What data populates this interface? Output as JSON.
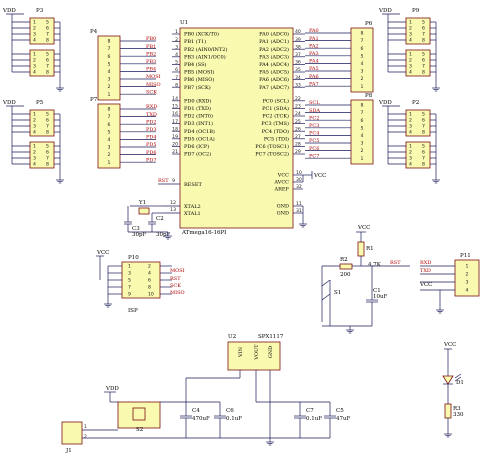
{
  "headers": {
    "p3": {
      "ref": "P3",
      "top": "VDD"
    },
    "p4": {
      "ref": "P4"
    },
    "p5": {
      "ref": "P5",
      "top": "VDD"
    },
    "p6": {
      "ref": "P6"
    },
    "p7": {
      "ref": "P7"
    },
    "p8": {
      "ref": "P8"
    },
    "p9": {
      "ref": "P9",
      "top": "VDD"
    },
    "p2": {
      "ref": "P2",
      "top": "VDD"
    },
    "pins_left": [
      "1",
      "2",
      "3",
      "4"
    ],
    "pins_right": [
      "5",
      "6",
      "7",
      "8"
    ]
  },
  "p4_rows": [
    "8",
    "7",
    "6",
    "5",
    "4",
    "3",
    "2",
    "1"
  ],
  "p4_nets": [
    "PB0",
    "PB1",
    "PB2",
    "PB3",
    "PB4",
    "MOSI",
    "MISO",
    "SCK"
  ],
  "p7_rows": [
    "8",
    "7",
    "6",
    "5",
    "4",
    "3",
    "2",
    "1"
  ],
  "p7_nets": [
    "RXD",
    "TXD",
    "PD2",
    "PD3",
    "PD4",
    "PD5",
    "PD6",
    "PD7"
  ],
  "p6_rows": [
    "8",
    "7",
    "6",
    "5",
    "4",
    "3",
    "2",
    "1"
  ],
  "p6_nets": [
    "PA0",
    "PA1",
    "PA2",
    "PA3",
    "PA4",
    "PA5",
    "PA6",
    "PA7"
  ],
  "p8_rows": [
    "8",
    "7",
    "6",
    "5",
    "4",
    "3",
    "2",
    "1"
  ],
  "p8_nets": [
    "SCL",
    "SDA",
    "PC2",
    "PC3",
    "PC4",
    "PC5",
    "PC6",
    "PC7"
  ],
  "u1": {
    "ref": "U1",
    "part": "ATmega16-16PI",
    "left_pins": [
      {
        "num": "1",
        "name": "PB0 (XCK/T0)"
      },
      {
        "num": "2",
        "name": "PB1 (T1)"
      },
      {
        "num": "3",
        "name": "PB2 (AIN0/INT2)"
      },
      {
        "num": "4",
        "name": "PB3 (AIN1/OC0)"
      },
      {
        "num": "5",
        "name": "PB4 (SS)"
      },
      {
        "num": "6",
        "name": "PB5 (MOSI)"
      },
      {
        "num": "7",
        "name": "PB6 (MISO)"
      },
      {
        "num": "8",
        "name": "PB7 (SCK)"
      },
      {
        "num": "14",
        "name": "PD0 (RXD)"
      },
      {
        "num": "15",
        "name": "PD1 (TXD)"
      },
      {
        "num": "16",
        "name": "PD2 (INT0)"
      },
      {
        "num": "17",
        "name": "PD3 (INT1)"
      },
      {
        "num": "18",
        "name": "PD4 (OC1B)"
      },
      {
        "num": "19",
        "name": "PD5 (OC1A)"
      },
      {
        "num": "20",
        "name": "PD6 (ICP)"
      },
      {
        "num": "21",
        "name": "PD7 (OC2)"
      }
    ],
    "right_pins": [
      {
        "num": "40",
        "name": "PA0 (ADC0)"
      },
      {
        "num": "39",
        "name": "PA1 (ADC1)"
      },
      {
        "num": "38",
        "name": "PA2 (ADC2)"
      },
      {
        "num": "37",
        "name": "PA3 (ADC3)"
      },
      {
        "num": "36",
        "name": "PA4 (ADC4)"
      },
      {
        "num": "35",
        "name": "PA5 (ADC5)"
      },
      {
        "num": "34",
        "name": "PA6 (ADC6)"
      },
      {
        "num": "33",
        "name": "PA7 (ADC7)"
      },
      {
        "num": "22",
        "name": "PC0 (SCL)"
      },
      {
        "num": "23",
        "name": "PC1 (SDA)"
      },
      {
        "num": "24",
        "name": "PC2 (TCK)"
      },
      {
        "num": "25",
        "name": "PC3 (TMS)"
      },
      {
        "num": "26",
        "name": "PC4 (TDO)"
      },
      {
        "num": "27",
        "name": "PC5 (TDI)"
      },
      {
        "num": "28",
        "name": "PC6 (TOSC1)"
      },
      {
        "num": "29",
        "name": "PC7 (TOSC2)"
      }
    ],
    "reset": {
      "net": "RST",
      "num": "9",
      "name": "RESET"
    },
    "xtal1": {
      "num": "13",
      "name": "XTAL1"
    },
    "xtal2": {
      "num": "12",
      "name": "XTAL2"
    },
    "vcc": {
      "num": "10",
      "name": "VCC"
    },
    "avcc": {
      "num": "30",
      "name": "AVCC"
    },
    "aref": {
      "num": "32",
      "name": "AREF"
    },
    "gnd1": {
      "num": "11",
      "name": "GND"
    },
    "gnd2": {
      "num": "31",
      "name": "GND"
    },
    "vcc_net": "VCC"
  },
  "crystal": {
    "ref": "Y1",
    "c2": "C2",
    "c3": "C3",
    "c2_val": "30pF",
    "c3_val": "30pF"
  },
  "p10": {
    "ref": "P10",
    "top": "VCC",
    "label": "ISP",
    "left_pins": [
      "1",
      "3",
      "5",
      "7",
      "9"
    ],
    "right_pins": [
      "2",
      "4",
      "6",
      "8",
      "10"
    ],
    "nets": [
      "MOSI",
      "RST",
      "SCK",
      "MISO"
    ]
  },
  "reset": {
    "vcc": "VCC",
    "r1": "R1",
    "r1_val": "4.7K",
    "r2": "R2",
    "r2_val": "200",
    "rst": "RST",
    "s1": "S1",
    "c1": "C1",
    "c1_val": "10uF"
  },
  "p11": {
    "ref": "P11",
    "nets": [
      "RXD",
      "TXD",
      "VCC"
    ],
    "pins": [
      "1",
      "2",
      "3",
      "4"
    ]
  },
  "u2": {
    "ref": "U2",
    "part": "SPX1117",
    "pins": [
      "VIN",
      "VOUT",
      "GND"
    ]
  },
  "led": {
    "vcc": "VCC",
    "d": "D1",
    "r": "R3",
    "r_val": "330"
  },
  "power": {
    "vdd": "VDD",
    "sw": "S2",
    "j1": "J1",
    "j_pins": [
      "1",
      "2"
    ],
    "c4": "C4",
    "c4_val": "470uF",
    "c6": "C6",
    "c6_val": "0.1uF",
    "c7": "C7",
    "c7_val": "0.1uF",
    "c5": "C5",
    "c5_val": "47uF"
  }
}
